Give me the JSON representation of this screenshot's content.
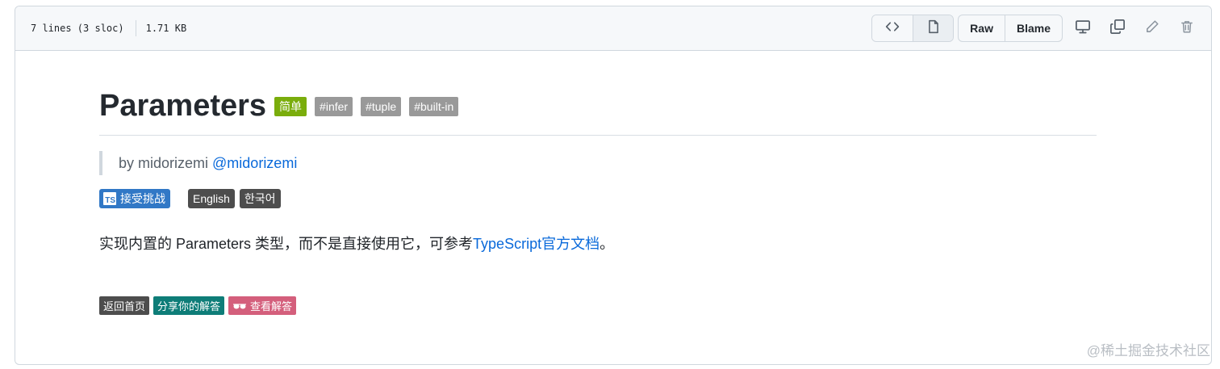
{
  "header": {
    "lines": "7 lines (3 sloc)",
    "size": "1.71 KB",
    "raw_label": "Raw",
    "blame_label": "Blame"
  },
  "icons": {
    "code": "code-icon",
    "file": "file-icon",
    "display": "display-icon",
    "copy": "copy-icon",
    "edit": "pencil-icon",
    "delete": "trash-icon"
  },
  "readme": {
    "title": "Parameters",
    "difficulty": "简单",
    "tags": [
      "#infer",
      "#tuple",
      "#built-in"
    ],
    "author_prefix": "by midorizemi",
    "author_handle": "@midorizemi",
    "accept_challenge": "接受挑战",
    "ts_logo": "TS",
    "languages": [
      "English",
      "한국어"
    ],
    "description_text": "实现内置的 Parameters 类型，而不是直接使用它，可参考",
    "description_link": "TypeScript官方文档",
    "description_end": "。",
    "footer": {
      "back_home": "返回首页",
      "share": "分享你的解答",
      "view": "查看解答"
    }
  },
  "watermark": "@稀土掘金技术社区",
  "colors": {
    "easy": "#7aad0c",
    "tag": "#999999",
    "ts": "#3178c6",
    "share": "#0e7d78",
    "view": "#d45f7c",
    "link": "#0969da"
  }
}
